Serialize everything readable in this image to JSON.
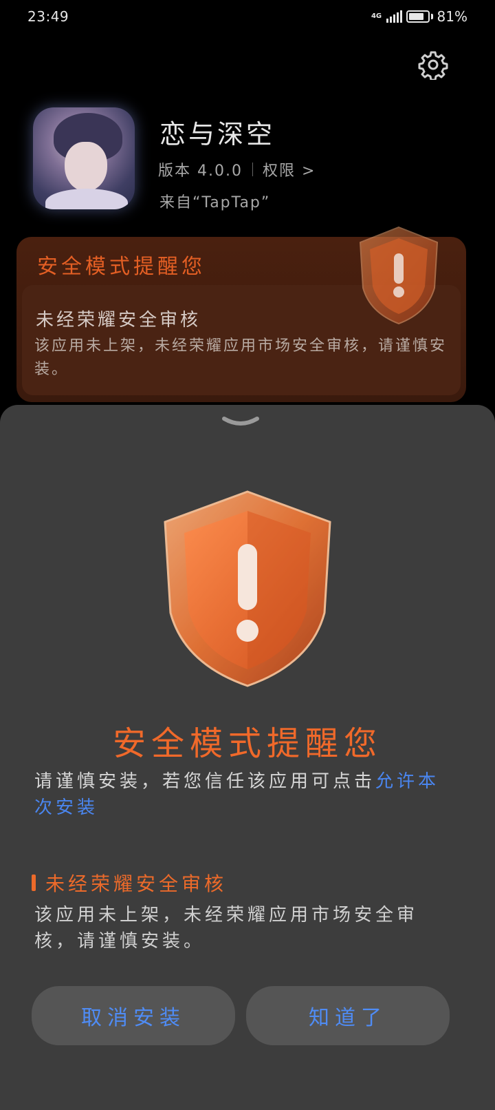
{
  "status_bar": {
    "time": "23:49",
    "network": "4G",
    "battery_percent": "81%",
    "battery_level": 0.81,
    "icons": [
      "signal-icon",
      "battery-icon"
    ]
  },
  "app": {
    "name": "恋与深空",
    "version": "版本 4.0.0",
    "permissions": "权限 >",
    "source": "来自“TapTap”",
    "icon": "app-icon"
  },
  "background_card": {
    "title": "安全模式提醒您",
    "subtitle": "未经荣耀安全审核",
    "description": "该应用未上架，未经荣耀应用市场安全审核，请谨慎安装。"
  },
  "sheet": {
    "title": "安全模式提醒您",
    "body_text": "请谨慎安装，若您信任该应用可点击",
    "allow_link": "允许本次安装",
    "reason_title": "未经荣耀安全审核",
    "reason_desc": "该应用未上架，未经荣耀应用市场安全审核，请谨慎安装。",
    "cancel_button": "取消安装",
    "ok_button": "知道了"
  },
  "colors": {
    "accent_orange": "#f0692a",
    "link_blue": "#4a86f0",
    "sheet_bg": "#3d3d3d"
  }
}
